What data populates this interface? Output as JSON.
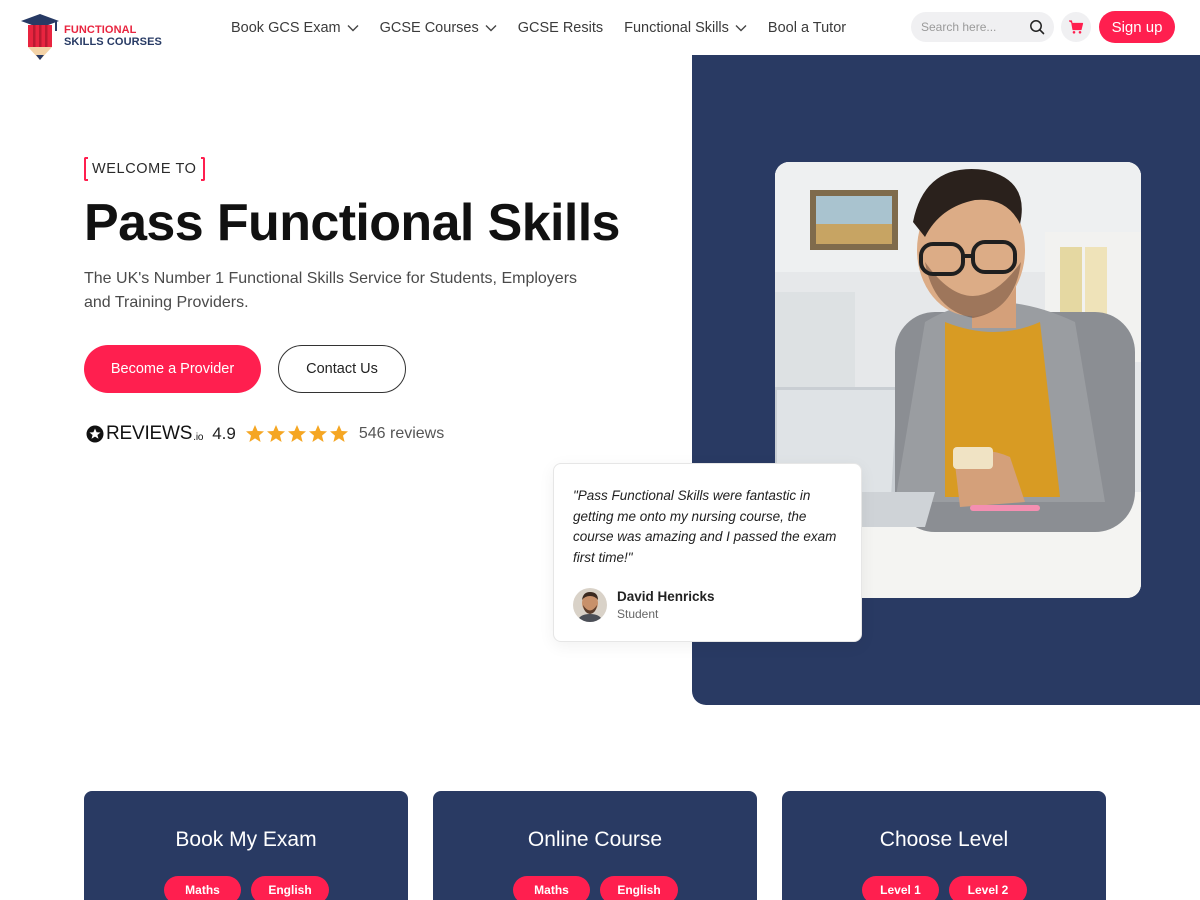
{
  "logo": {
    "line1": "FUNCTIONAL",
    "line2": "SKILLS COURSES"
  },
  "nav": {
    "items": [
      {
        "label": "Book GCS Exam",
        "dropdown": true
      },
      {
        "label": "GCSE Courses",
        "dropdown": true
      },
      {
        "label": "GCSE Resits",
        "dropdown": false
      },
      {
        "label": "Functional Skills",
        "dropdown": true
      },
      {
        "label": "Bool a Tutor",
        "dropdown": false
      }
    ],
    "search_placeholder": "Search here...",
    "signup_label": "Sign up"
  },
  "hero": {
    "eyebrow": "WELCOME TO",
    "title": "Pass Functional Skills",
    "subtitle": "The UK's Number 1 Functional Skills Service for Students, Employers and Training Providers.",
    "primary_button": "Become a Provider",
    "secondary_button": "Contact Us",
    "reviews": {
      "brand": "REVIEWS",
      "brand_suffix": ".io",
      "score": "4.9",
      "stars": 5,
      "count": "546 reviews"
    }
  },
  "testimonial": {
    "quote": "\"Pass Functional Skills were fantastic in getting me onto my nursing course, the course was amazing and I passed the exam first time!\"",
    "name": "David Henricks",
    "role": "Student"
  },
  "cards": [
    {
      "title": "Book My Exam",
      "pills": [
        "Maths",
        "English"
      ]
    },
    {
      "title": "Online Course",
      "pills": [
        "Maths",
        "English"
      ]
    },
    {
      "title": "Choose Level",
      "pills": [
        "Level 1",
        "Level 2"
      ]
    }
  ],
  "colors": {
    "accent": "#ff1f4f",
    "navy": "#293a63",
    "star": "#f5a623"
  }
}
